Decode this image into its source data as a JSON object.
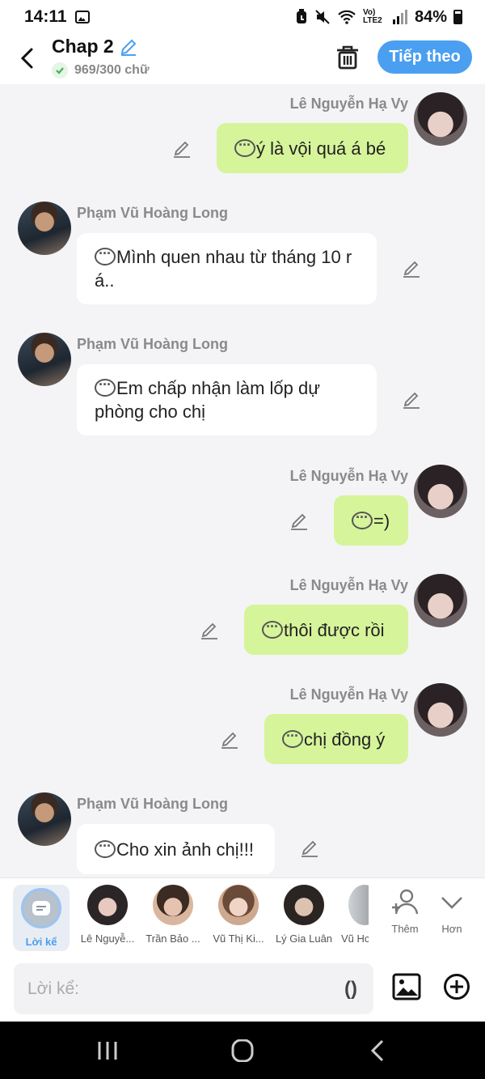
{
  "status": {
    "time": "14:11",
    "network": "Vo) LTE2",
    "battery": "84%"
  },
  "header": {
    "title": "Chap 2",
    "word_count": "969/300 chữ",
    "next_label": "Tiếp theo"
  },
  "messages": [
    {
      "sender": "Lê Nguyễn Hạ Vy",
      "text": "ý là vội quá á bé",
      "side": "right"
    },
    {
      "sender": "Phạm Vũ Hoàng Long",
      "text": "Mình quen nhau từ tháng 10 r á..",
      "side": "left"
    },
    {
      "sender": "Phạm Vũ Hoàng Long",
      "text": "Em chấp nhận làm lốp dự phòng cho chị",
      "side": "left"
    },
    {
      "sender": "Lê Nguyễn Hạ Vy",
      "text": "=)",
      "side": "right"
    },
    {
      "sender": "Lê Nguyễn Hạ Vy",
      "text": "thôi được rồi",
      "side": "right"
    },
    {
      "sender": "Lê Nguyễn Hạ Vy",
      "text": "chị đồng ý",
      "side": "right"
    },
    {
      "sender": "Phạm Vũ Hoàng Long",
      "text": "Cho xin ảnh chị!!!",
      "side": "left"
    }
  ],
  "characters": [
    {
      "label": "Lời kể",
      "selected": true
    },
    {
      "label": "Lê Nguyễ..."
    },
    {
      "label": "Trần Bảo ..."
    },
    {
      "label": "Vũ Thị Ki..."
    },
    {
      "label": "Lý Gia Luân"
    },
    {
      "label": "Vũ Hc"
    }
  ],
  "tools": {
    "more_label": "Thêm",
    "less_label": "Hơn"
  },
  "input": {
    "placeholder": "Lời kể:",
    "paren": "()"
  },
  "colors": {
    "accent": "#4a9ff0",
    "bubble_me": "#d6f49a",
    "bubble_them": "#ffffff",
    "background": "#f4f4f6"
  }
}
